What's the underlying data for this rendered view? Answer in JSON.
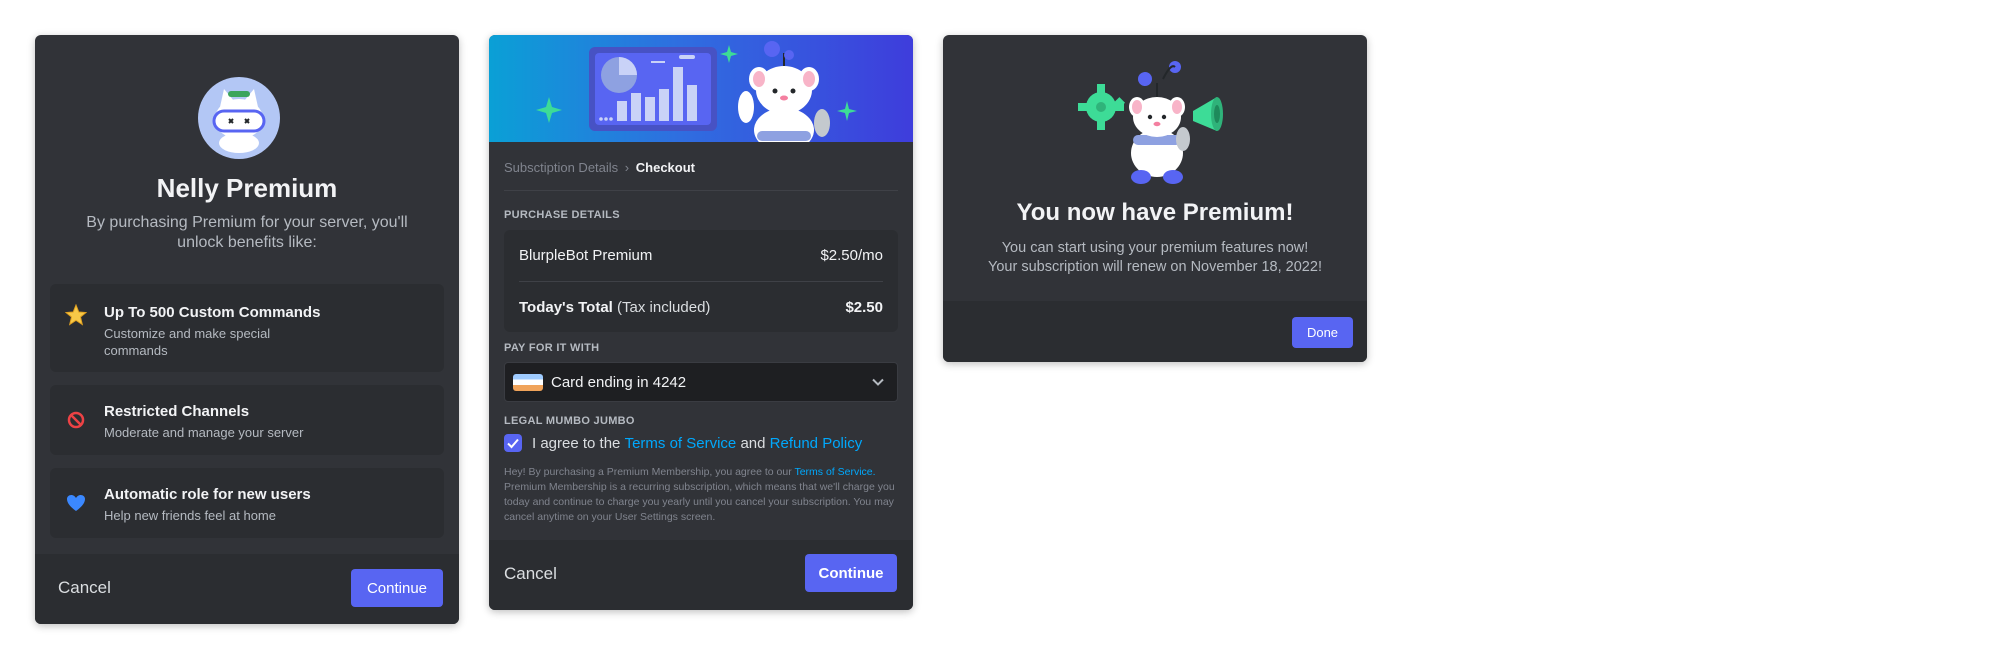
{
  "premium_modal": {
    "title": "Nelly Premium",
    "subtitle": "By purchasing Premium for your server, you'll unlock benefits like:",
    "benefits": [
      {
        "icon": "star-icon",
        "title": "Up To 500 Custom Commands",
        "desc": "Customize and make special commands"
      },
      {
        "icon": "no-entry-icon",
        "title": "Restricted Channels",
        "desc": "Moderate and manage your server"
      },
      {
        "icon": "blue-heart-icon",
        "title": "Automatic role for new users",
        "desc": "Help new friends feel at home"
      }
    ],
    "cancel_label": "Cancel",
    "continue_label": "Continue"
  },
  "checkout_modal": {
    "breadcrumb": {
      "previous": "Subsctiption Details",
      "separator": "›",
      "current": "Checkout"
    },
    "purchase_details_label": "PURCHASE DETAILS",
    "item_name": "BlurpleBot Premium",
    "item_price": "$2.50/mo",
    "total_label": "Today's Total",
    "total_note": "(Tax included)",
    "total_amount": "$2.50",
    "pay_label": "PAY FOR IT WITH",
    "card_text": "Card ending in 4242",
    "legal_label": "LEGAL MUMBO JUMBO",
    "agree_prefix": "I agree to the",
    "agree_tos": "Terms of Service",
    "agree_and": "and",
    "agree_refund": "Refund Policy",
    "fine_print_start": "Hey! By purchasing a Premium Membership, you agree to our",
    "fine_print_link": "Terms of Service.",
    "fine_print_rest": "Premium Membership is a recurring subscription, which means that we'll charge you today and continue to charge you yearly until you cancel your subscription. You may cancel anytime on your User Settings screen.",
    "cancel_label": "Cancel",
    "continue_label": "Continue"
  },
  "success_modal": {
    "title": "You now have Premium!",
    "line1": "You can start using your premium features now!",
    "line2": "Your subscription will renew on November 18, 2022!",
    "done_label": "Done"
  },
  "colors": {
    "brand": "#5865f2",
    "link": "#00a8fc",
    "modal_bg": "#313338",
    "footer_bg": "#2b2d31"
  }
}
